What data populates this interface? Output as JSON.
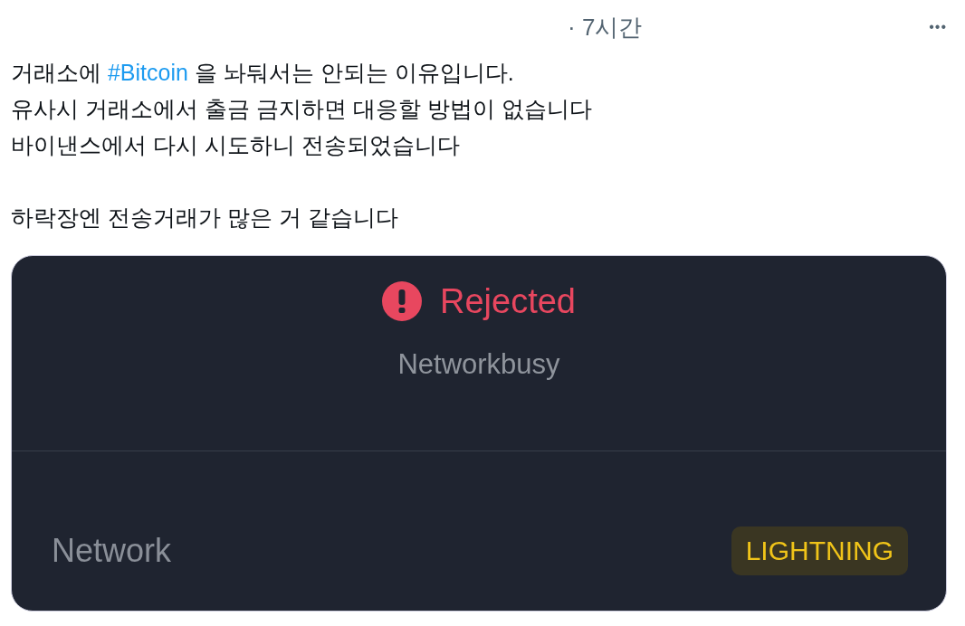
{
  "header": {
    "time": "· 7시간",
    "more": "•••"
  },
  "tweet": {
    "paragraphs": [
      [
        [
          {
            "kind": "text",
            "text": "거래소에 "
          },
          {
            "kind": "hashtag",
            "text": "#Bitcoin"
          },
          {
            "kind": "text",
            "text": " 을 놔둬서는 안되는 이유입니다."
          }
        ],
        [
          {
            "kind": "text",
            "text": "유사시 거래소에서 출금 금지하면 대응할 방법이 없습니다"
          }
        ],
        [
          {
            "kind": "text",
            "text": "바이낸스에서 다시 시도하니 전송되었습니다"
          }
        ]
      ],
      [
        [
          {
            "kind": "text",
            "text": "하락장엔 전송거래가 많은 거 같습니다"
          }
        ]
      ]
    ]
  },
  "card": {
    "status": "Rejected",
    "reason": "Networkbusy",
    "field_label": "Network",
    "field_value": "LIGHTNING"
  }
}
